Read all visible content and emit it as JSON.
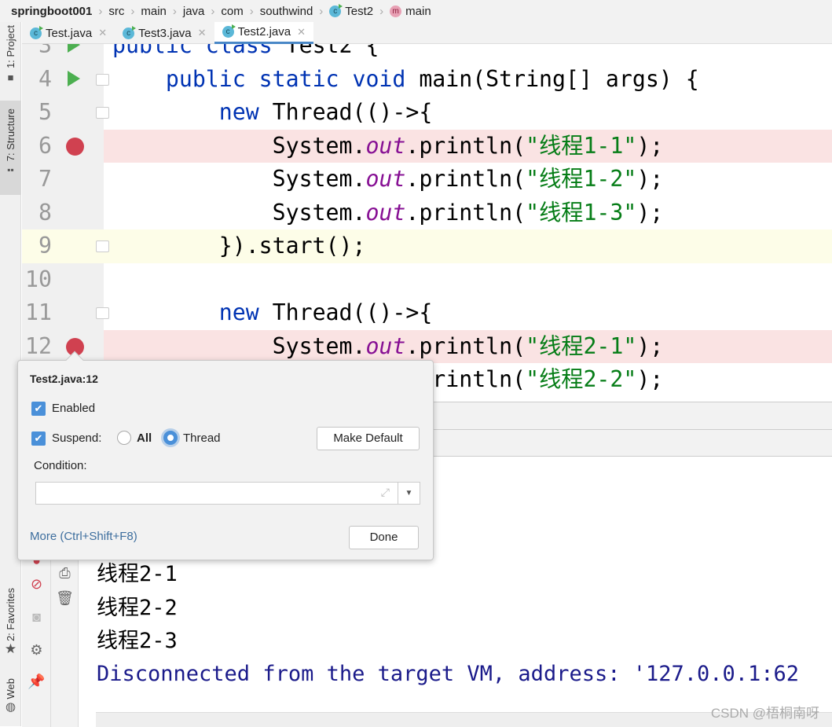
{
  "breadcrumb": [
    "springboot001",
    "src",
    "main",
    "java",
    "com",
    "southwind",
    "Test2",
    "main"
  ],
  "tabs": [
    {
      "label": "Test.java",
      "active": false
    },
    {
      "label": "Test3.java",
      "active": false
    },
    {
      "label": "Test2.java",
      "active": true
    }
  ],
  "left_strip": {
    "project": "1: Project",
    "structure": "7: Structure",
    "favorites": "2: Favorites",
    "web": "Web"
  },
  "editor": {
    "lines": [
      {
        "n": "3",
        "code": [
          [
            "kw",
            "public class "
          ],
          [
            "",
            "Test2 {"
          ]
        ]
      },
      {
        "n": "4",
        "code": [
          [
            "",
            "    "
          ],
          [
            "kw",
            "public static void "
          ],
          [
            "",
            "main(String[] args) {"
          ]
        ]
      },
      {
        "n": "5",
        "code": [
          [
            "",
            "        "
          ],
          [
            "kw",
            "new "
          ],
          [
            "",
            "Thread(()->{"
          ]
        ]
      },
      {
        "n": "6",
        "code": [
          [
            "",
            "            System."
          ],
          [
            "fld",
            "out"
          ],
          [
            "",
            ".println("
          ],
          [
            "str",
            "\"线程1-1\""
          ],
          [
            "",
            ");"
          ]
        ]
      },
      {
        "n": "7",
        "code": [
          [
            "",
            "            System."
          ],
          [
            "fld",
            "out"
          ],
          [
            "",
            ".println("
          ],
          [
            "str",
            "\"线程1-2\""
          ],
          [
            "",
            ");"
          ]
        ]
      },
      {
        "n": "8",
        "code": [
          [
            "",
            "            System."
          ],
          [
            "fld",
            "out"
          ],
          [
            "",
            ".println("
          ],
          [
            "str",
            "\"线程1-3\""
          ],
          [
            "",
            ");"
          ]
        ]
      },
      {
        "n": "9",
        "code": [
          [
            "",
            "        }).start();"
          ]
        ]
      },
      {
        "n": "10",
        "code": []
      },
      {
        "n": "11",
        "code": [
          [
            "",
            "        "
          ],
          [
            "kw",
            "new "
          ],
          [
            "",
            "Thread(()->{"
          ]
        ]
      },
      {
        "n": "12",
        "code": [
          [
            "",
            "            System."
          ],
          [
            "fld",
            "out"
          ],
          [
            "",
            ".println("
          ],
          [
            "str",
            "\"线程2-1\""
          ],
          [
            "",
            ");"
          ]
        ]
      },
      {
        "n": "13",
        "code": [
          [
            "",
            "            System."
          ],
          [
            "fld",
            "out"
          ],
          [
            "",
            ".println("
          ],
          [
            "str",
            "\"线程2-2\""
          ],
          [
            "",
            ");"
          ]
        ]
      }
    ],
    "breakpoint_lines": [
      "6",
      "12"
    ],
    "run_lines": [
      "3",
      "4"
    ],
    "fold_lines": [
      "4",
      "5",
      "9",
      "11"
    ],
    "current_line": "9"
  },
  "console": {
    "lines": [
      "线程2-1",
      "线程2-2",
      "线程2-3"
    ],
    "system_line": "Disconnected from the target VM, address: '127.0.0.1:62"
  },
  "popup": {
    "title": "Test2.java:12",
    "enabled_label": "Enabled",
    "enabled": true,
    "suspend_label": "Suspend:",
    "suspend": true,
    "suspend_options": [
      "All",
      "Thread"
    ],
    "suspend_selected": "Thread",
    "make_default": "Make Default",
    "condition_label": "Condition:",
    "condition_value": "",
    "more_link": "More (Ctrl+Shift+F8)",
    "done": "Done"
  },
  "watermark": "CSDN @梧桐南呀",
  "colors": {
    "breakpoint": "#d04150",
    "keyword": "#0033b3",
    "string": "#067d17",
    "field": "#871094",
    "accent": "#4a90d9"
  }
}
